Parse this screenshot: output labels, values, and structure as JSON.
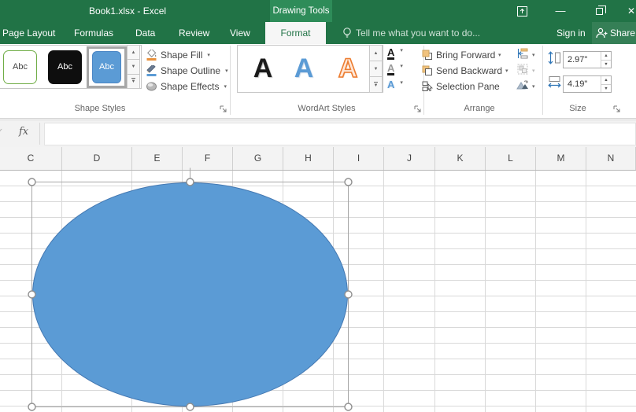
{
  "window": {
    "title": "Book1.xlsx - Excel",
    "contextual_tools": "Drawing Tools",
    "minimize": "—",
    "close": "✕"
  },
  "tabs": {
    "page_layout": "Page Layout",
    "formulas": "Formulas",
    "data": "Data",
    "review": "Review",
    "view": "View",
    "format": "Format",
    "tell_me": "Tell me what you want to do...",
    "sign_in": "Sign in",
    "share": "Share"
  },
  "ribbon": {
    "shape_styles": {
      "label": "Shape Styles",
      "preset1": "Abc",
      "preset2": "Abc",
      "preset3": "Abc",
      "shape_fill": "Shape Fill",
      "shape_outline": "Shape Outline",
      "shape_effects": "Shape Effects"
    },
    "wordart": {
      "label": "WordArt Styles",
      "a_black": "A",
      "a_blue": "A",
      "a_orange": "A",
      "text_fill": "A",
      "text_outline": "A",
      "text_effects": "A"
    },
    "arrange": {
      "label": "Arrange",
      "bring_forward": "Bring Forward",
      "send_backward": "Send Backward",
      "selection_pane": "Selection Pane"
    },
    "size": {
      "label": "Size",
      "height_value": "2.97\"",
      "width_value": "4.19\""
    }
  },
  "formula_bar": {
    "fx_label": "fx",
    "check": "✓"
  },
  "sheet": {
    "columns": [
      "C",
      "D",
      "E",
      "F",
      "G",
      "H",
      "I",
      "J",
      "K",
      "L",
      "M",
      "N"
    ]
  },
  "shape": {
    "type": "oval",
    "fill_color": "#5B9BD5",
    "outline_color": "#4579B2"
  },
  "icons": {
    "caret": "▾",
    "scroll_up": "▲",
    "scroll_down": "▼",
    "spin_up": "▲",
    "spin_down": "▼"
  },
  "colors": {
    "title_green": "#217346",
    "contextual_green": "#2E8C59",
    "accent_blue": "#5B9BD5",
    "accent_orange": "#ED7D31",
    "preset_border_green": "#70AD47"
  }
}
